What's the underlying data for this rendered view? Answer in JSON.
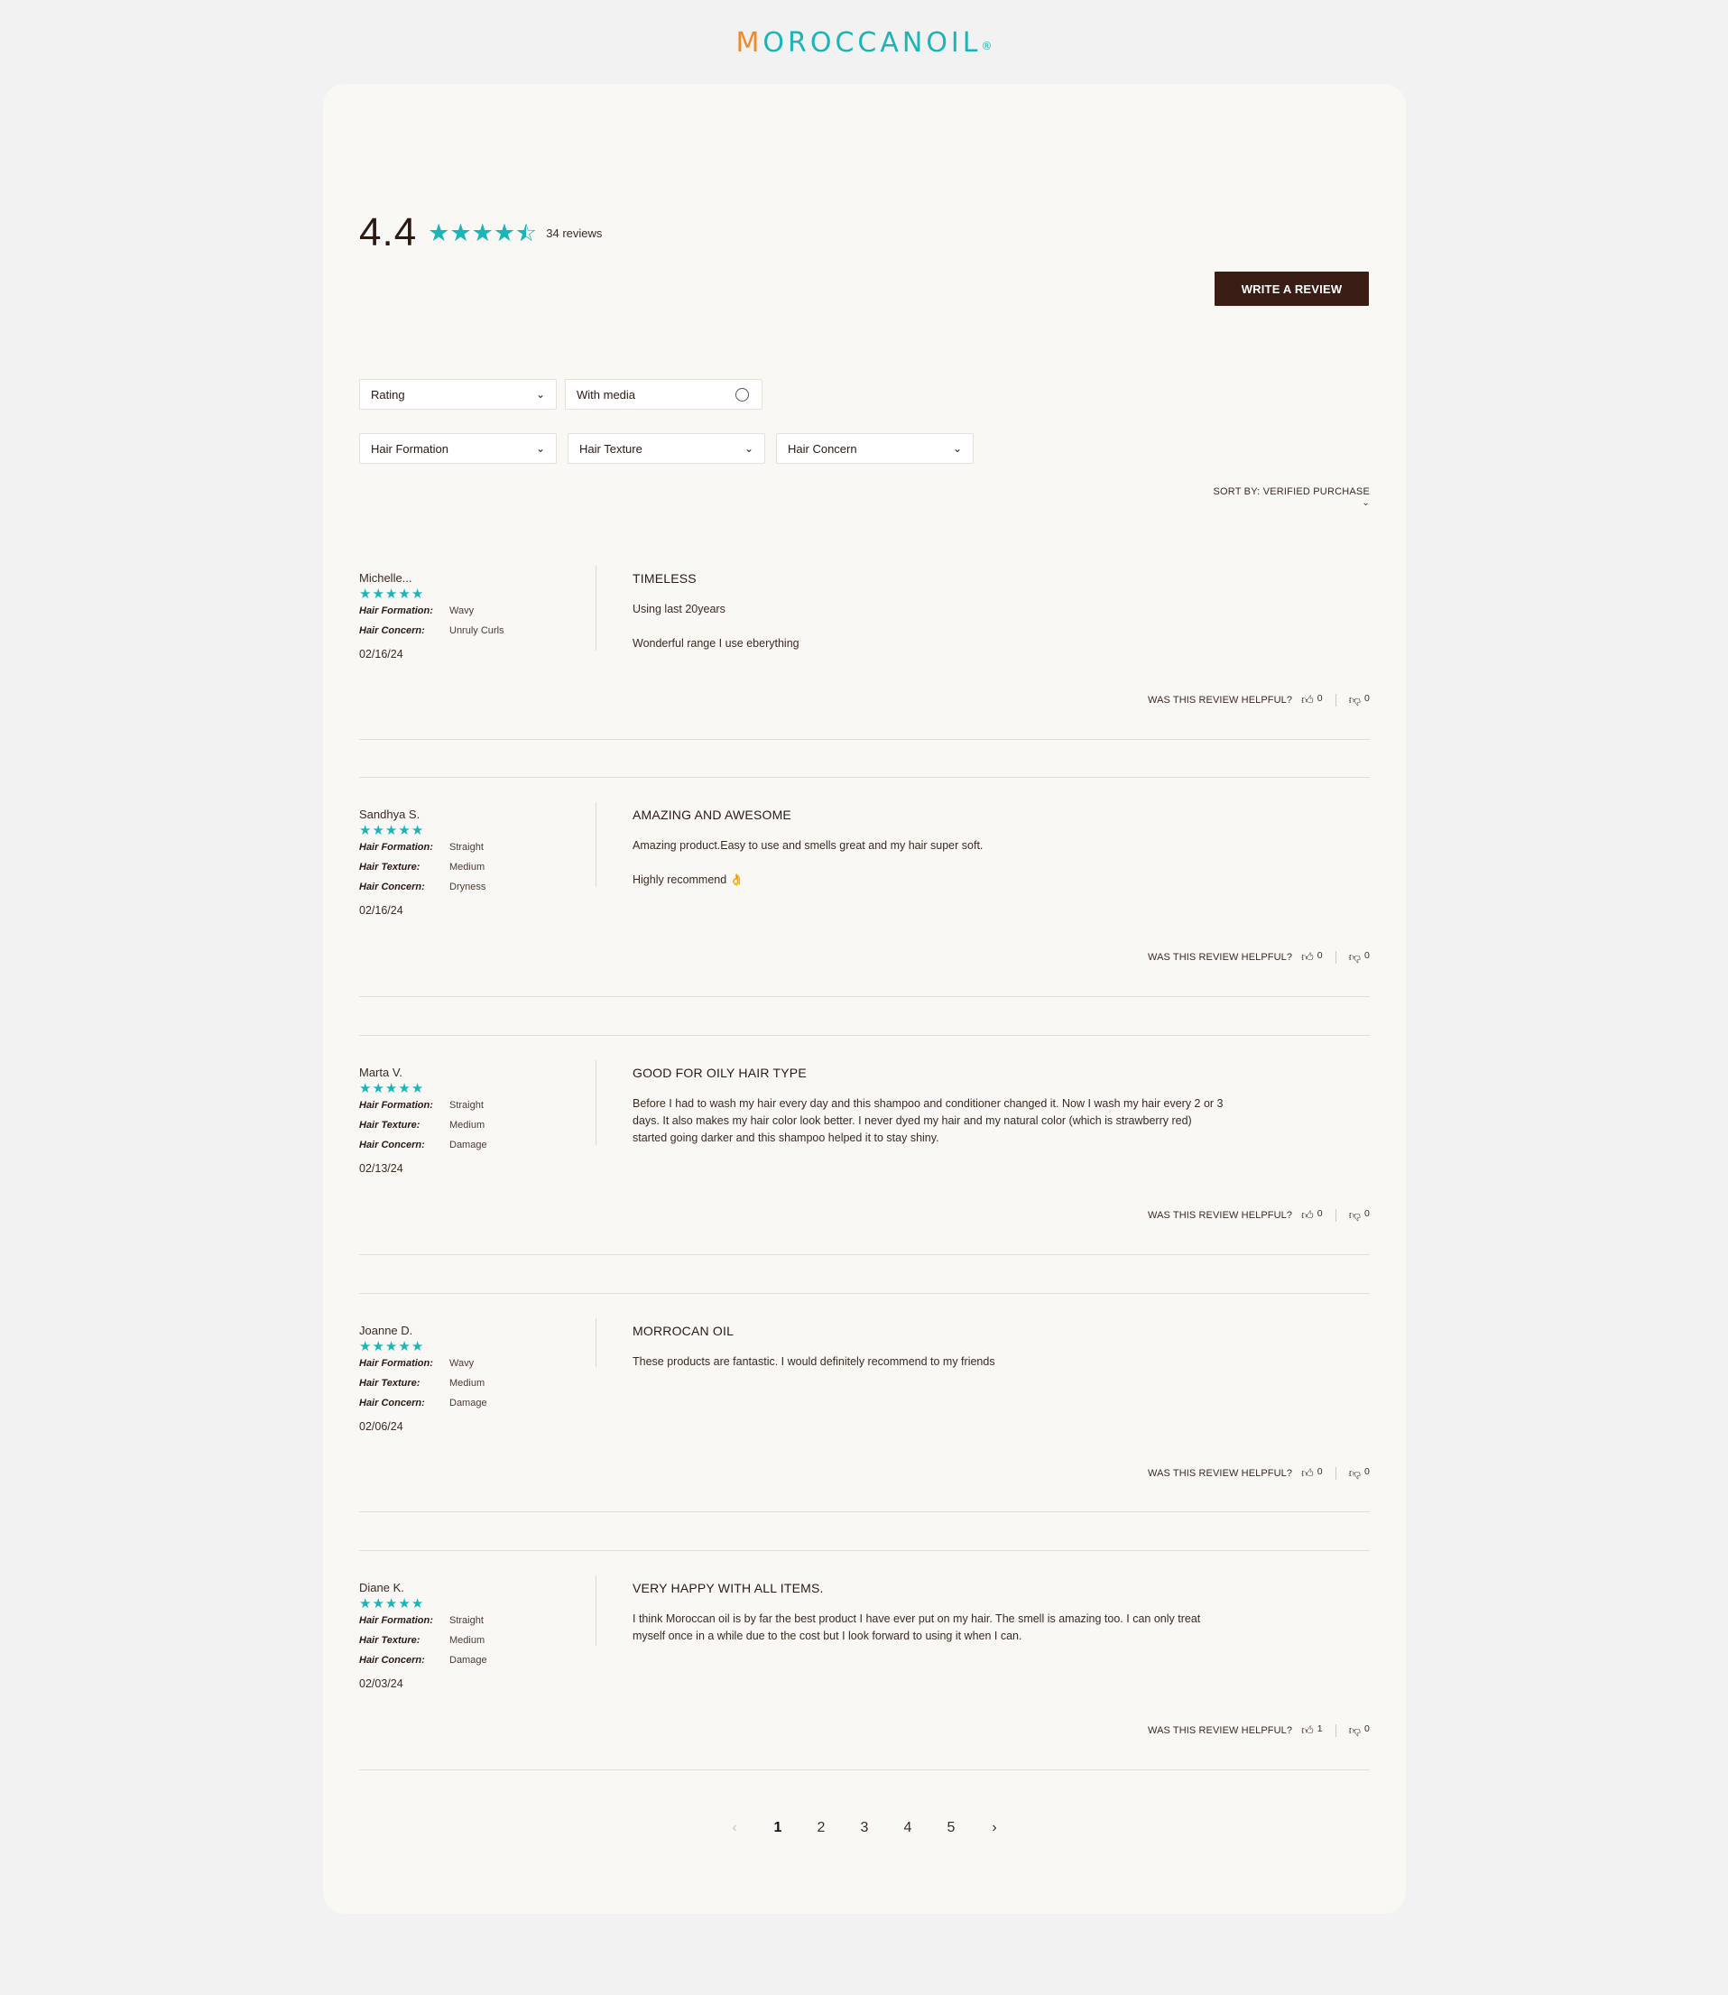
{
  "brand": {
    "logo_first": "M",
    "logo_rest": "OROCCANOIL",
    "logo_mark": "®"
  },
  "summary": {
    "average": "4.4",
    "rating_value": 4.4,
    "count_label": "34 reviews"
  },
  "actions": {
    "write_review": "WRITE A REVIEW"
  },
  "filters": {
    "rating": "Rating",
    "with_media": "With media",
    "hair_formation": "Hair Formation",
    "hair_texture": "Hair Texture",
    "hair_concern": "Hair Concern"
  },
  "sort": {
    "label": "SORT BY:",
    "value": "VERIFIED PURCHASE"
  },
  "helpful_label": "WAS THIS REVIEW HELPFUL?",
  "attr_labels": {
    "formation": "Hair Formation:",
    "texture": "Hair Texture:",
    "concern": "Hair Concern:"
  },
  "reviews": [
    {
      "author": "Michelle...",
      "rating": 5,
      "formation": "Wavy",
      "concern": "Unruly Curls",
      "date": "02/16/24",
      "title": "TIMELESS",
      "body": [
        "Using last 20years",
        "Wonderful range I use eberything"
      ],
      "up": "0",
      "down": "0"
    },
    {
      "author": "Sandhya S.",
      "rating": 5,
      "formation": "Straight",
      "texture": "Medium",
      "concern": "Dryness",
      "date": "02/16/24",
      "title": "AMAZING AND AWESOME",
      "body": [
        "Amazing product.Easy to use and smells great and my hair super soft.",
        "Highly recommend 👌"
      ],
      "up": "0",
      "down": "0"
    },
    {
      "author": "Marta V.",
      "rating": 5,
      "formation": "Straight",
      "texture": "Medium",
      "concern": "Damage",
      "date": "02/13/24",
      "title": "GOOD FOR OILY HAIR TYPE",
      "body": [
        "Before I had to wash my hair every day and this shampoo and conditioner changed it. Now I wash my hair every 2 or 3 days. It also makes my hair color look better. I never dyed my hair and my natural color (which is strawberry red) started going darker and this shampoo helped it to stay shiny."
      ],
      "up": "0",
      "down": "0"
    },
    {
      "author": "Joanne D.",
      "rating": 5,
      "formation": "Wavy",
      "texture": "Medium",
      "concern": "Damage",
      "date": "02/06/24",
      "title": "MORROCAN OIL",
      "body": [
        "These products are fantastic. I would definitely recommend to my friends"
      ],
      "up": "0",
      "down": "0"
    },
    {
      "author": "Diane K.",
      "rating": 5,
      "formation": "Straight",
      "texture": "Medium",
      "concern": "Damage",
      "date": "02/03/24",
      "title": "VERY HAPPY WITH ALL ITEMS.",
      "body": [
        "I think Moroccan oil is by far the best product I have ever put on my hair. The smell is amazing too. I can only treat myself once in a while due to the cost but I look forward to using it when I can."
      ],
      "up": "1",
      "down": "0"
    }
  ],
  "pagination": {
    "pages": [
      "1",
      "2",
      "3",
      "4",
      "5"
    ],
    "current": "1",
    "prev": "‹",
    "next": "›"
  },
  "colors": {
    "accent": "#1bb4b7",
    "brand_orange": "#f08a2b",
    "button": "#3a1d14",
    "card": "#faf8f4",
    "page": "#f2f2f2"
  },
  "icons": {
    "star": "star-icon",
    "thumbs_up": "thumbs-up-icon",
    "thumbs_down": "thumbs-down-icon",
    "chevron": "chevron-down-icon"
  }
}
